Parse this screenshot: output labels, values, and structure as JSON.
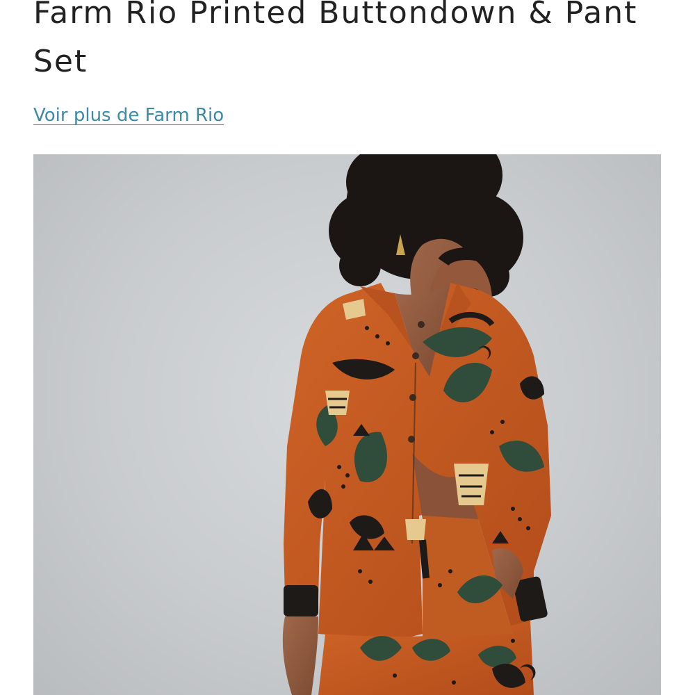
{
  "product": {
    "title": "Farm Rio Printed Buttondown & Pant Set",
    "brand_link": "Voir plus de Farm Rio"
  },
  "image": {
    "description_icon": "product-photo",
    "background_color": "#cdd0d2",
    "garment_color": "#c4581f",
    "print_green": "#2f4d3a",
    "print_dark": "#1d1a17",
    "print_cream": "#e6c98f"
  },
  "colors": {
    "title": "#222222",
    "link": "#3c8aa5"
  }
}
